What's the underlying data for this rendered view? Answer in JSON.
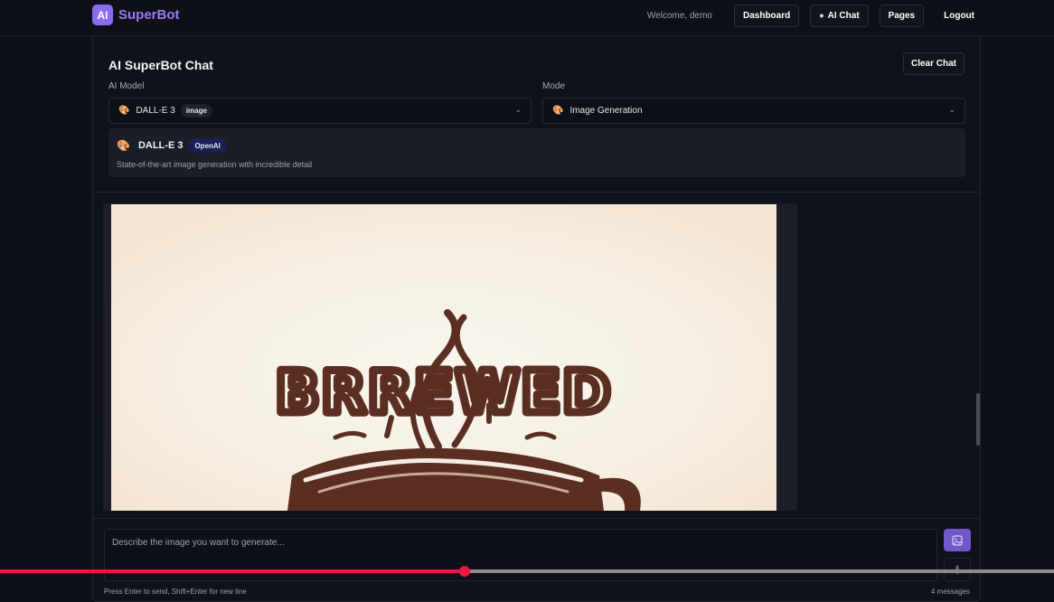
{
  "brand": {
    "logo": "AI",
    "name": "SuperBot"
  },
  "nav": {
    "welcome": "Welcome, demo",
    "dashboard": "Dashboard",
    "ai_chat": "AI Chat",
    "pages": "Pages",
    "logout": "Logout"
  },
  "chat": {
    "title": "AI SuperBot Chat",
    "clear_label": "Clear Chat",
    "model_label": "AI Model",
    "mode_label": "Mode",
    "model_select": {
      "value": "DALL-E 3",
      "tag": "image"
    },
    "mode_select": {
      "value": "Image Generation"
    },
    "model_info": {
      "name": "DALL-E 3",
      "provider": "OpenAI",
      "description": "State-of-the-art image generation with incredible detail"
    }
  },
  "generated_image": {
    "text": "BRREWED"
  },
  "input": {
    "placeholder": "Describe the image you want to generate...",
    "hint": "Press Enter to send, Shift+Enter for new line",
    "message_count": "4 messages"
  },
  "video_progress": {
    "played_fraction": 0.441,
    "buffered_fraction": 0.316
  },
  "colors": {
    "background": "#0e1017",
    "brand": "#9b7cf5",
    "accent_button": "#6f58c9",
    "provider_badge": "#1a1f56",
    "progress": "#f0163f",
    "image_ink": "#5b2e22"
  },
  "icons": {
    "chat": "chat-bubble-icon",
    "palette": "palette-icon",
    "chevron": "chevron-down-icon",
    "generate": "image-generate-icon",
    "mic": "microphone-icon"
  }
}
